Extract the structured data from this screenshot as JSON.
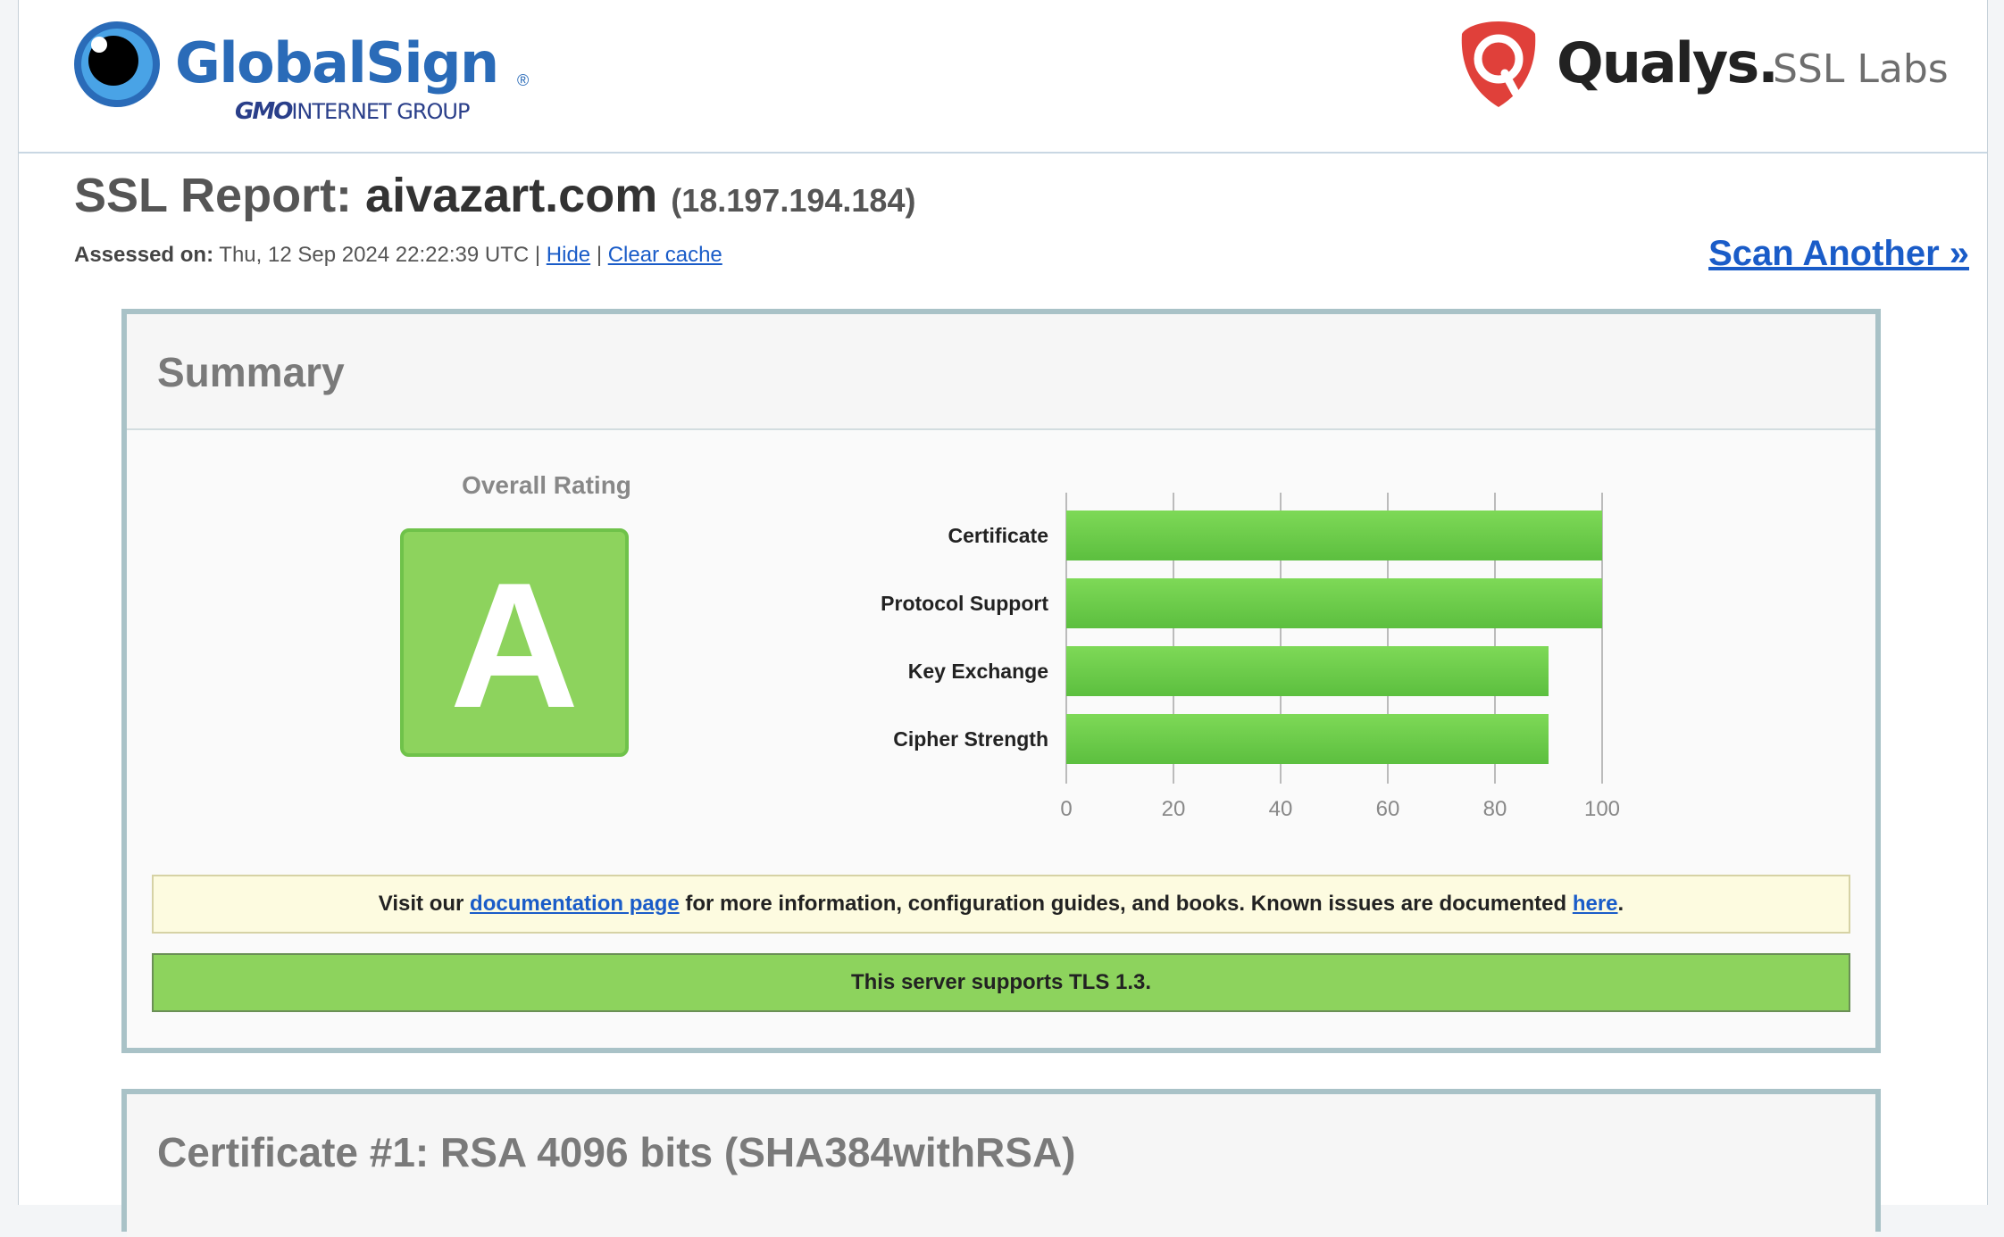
{
  "header": {
    "globalsign": {
      "name": "GlobalSign",
      "registered": "®",
      "group_bold": "GMO",
      "group_rest": "INTERNET GROUP"
    },
    "qualys": {
      "name": "Qualys.",
      "product": "SSL Labs",
      "brand_color": "#e0403a"
    }
  },
  "report": {
    "title_prefix": "SSL Report:",
    "domain": "aivazart.com",
    "ip": "(18.197.194.184)",
    "assessed_label": "Assessed on:",
    "assessed_value": "Thu, 12 Sep 2024 22:22:39 UTC",
    "separator": "|",
    "hide_label": "Hide",
    "clear_cache_label": "Clear cache",
    "scan_another_label": "Scan Another »"
  },
  "summary": {
    "title": "Summary",
    "overall_rating_label": "Overall Rating",
    "grade": "A",
    "grade_color": "#8dd35d",
    "doc_notice": {
      "before": "Visit our ",
      "link1": "documentation page",
      "middle": " for more information, configuration guides, and books. Known issues are documented ",
      "link2": "here",
      "after": "."
    },
    "tls_notice": "This server supports TLS 1.3."
  },
  "chart_data": {
    "type": "bar",
    "orientation": "horizontal",
    "categories": [
      "Certificate",
      "Protocol Support",
      "Key Exchange",
      "Cipher Strength"
    ],
    "values": [
      100,
      100,
      90,
      90
    ],
    "xlim": [
      0,
      100
    ],
    "xticks": [
      0,
      20,
      40,
      60,
      80,
      100
    ],
    "grid": true,
    "bar_color": "#5cbf3f"
  },
  "certificate": {
    "title": "Certificate #1: RSA 4096 bits (SHA384withRSA)"
  }
}
